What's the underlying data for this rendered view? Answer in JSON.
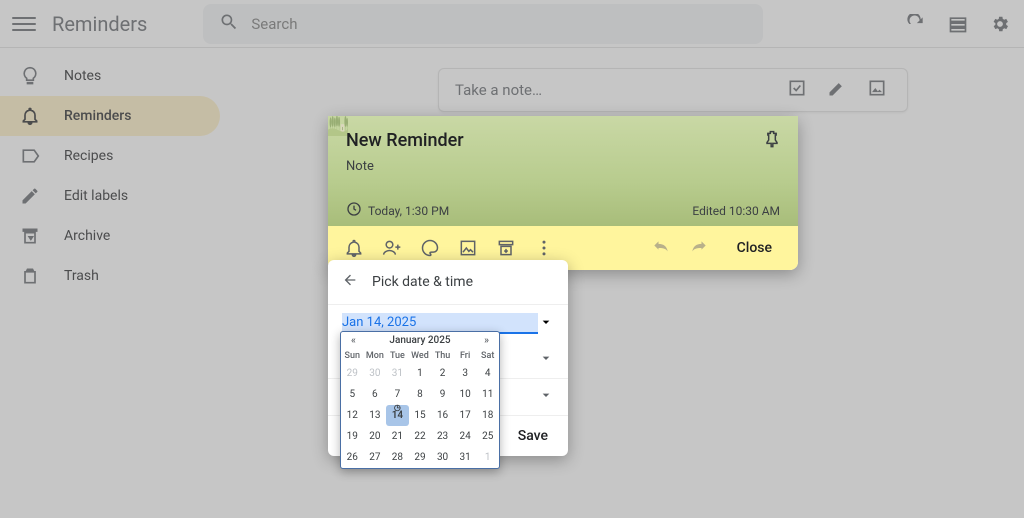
{
  "header": {
    "app_title": "Reminders",
    "search_placeholder": "Search"
  },
  "sidebar": {
    "items": [
      {
        "label": "Notes",
        "icon": "lightbulb-icon",
        "active": false
      },
      {
        "label": "Reminders",
        "icon": "bell-icon",
        "active": true
      },
      {
        "label": "Recipes",
        "icon": "label-icon",
        "active": false
      },
      {
        "label": "Edit labels",
        "icon": "pencil-icon",
        "active": false
      },
      {
        "label": "Archive",
        "icon": "archive-icon",
        "active": false
      },
      {
        "label": "Trash",
        "icon": "trash-icon",
        "active": false
      }
    ]
  },
  "take_note": {
    "placeholder": "Take a note…"
  },
  "reminder": {
    "title": "New Reminder",
    "note": "Note",
    "time_chip": "Today, 1:30 PM",
    "edited": "Edited 10:30 AM",
    "close_label": "Close"
  },
  "date_panel": {
    "title": "Pick date & time",
    "date_value": "Jan 14, 2025",
    "save_label": "Save"
  },
  "calendar": {
    "month_label": "January 2025",
    "days_of_week": [
      "Sun",
      "Mon",
      "Tue",
      "Wed",
      "Thu",
      "Fri",
      "Sat"
    ],
    "prev_trail": [
      29,
      30,
      31
    ],
    "days": [
      1,
      2,
      3,
      4,
      5,
      6,
      7,
      8,
      9,
      10,
      11,
      12,
      13,
      14,
      15,
      16,
      17,
      18,
      19,
      20,
      21,
      22,
      23,
      24,
      25,
      26,
      27,
      28,
      29,
      30,
      31
    ],
    "next_lead": [
      1
    ],
    "selected_day": 14
  }
}
